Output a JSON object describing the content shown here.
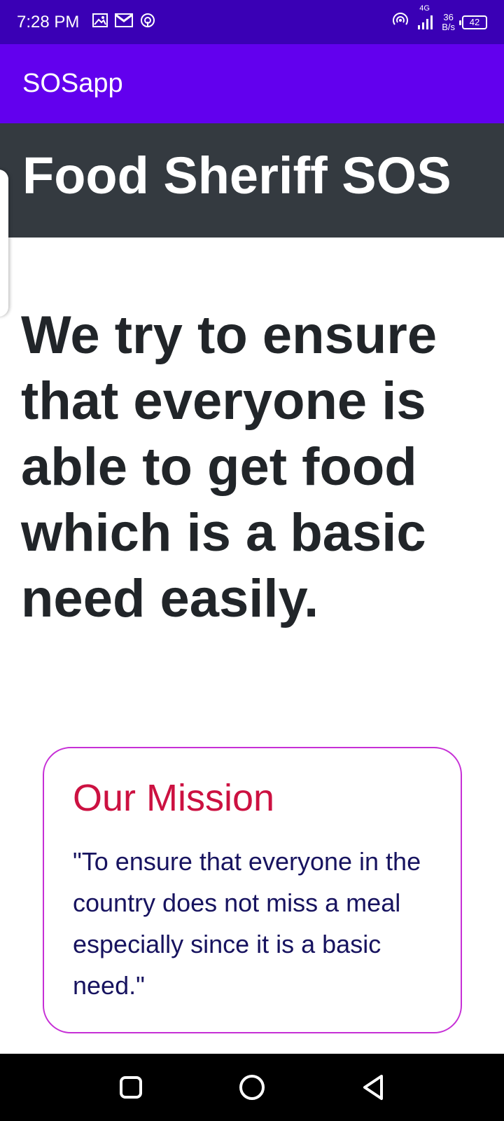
{
  "status_bar": {
    "time": "7:28 PM",
    "network_type": "4G",
    "net_speed_value": "36",
    "net_speed_unit": "B/s",
    "battery": "42",
    "left_icons": [
      "gallery-icon",
      "gmail-icon",
      "hotspot-icon"
    ],
    "right_icons": [
      "hotspot-icon",
      "signal-icon",
      "battery-icon"
    ]
  },
  "app_bar": {
    "title": "SOSapp"
  },
  "site_header": {
    "title": "Food Sheriff SOS"
  },
  "hero": {
    "text": "We try to ensure that everyone is able to get food which is a basic need easily."
  },
  "mission": {
    "heading": "Our Mission",
    "text": "\"To ensure that everyone in the country does not miss a meal especially since it is a basic need.\""
  },
  "nav_bar": {
    "buttons": [
      "recents-icon",
      "home-icon",
      "back-icon"
    ]
  },
  "colors": {
    "status_bar": "#3a00b5",
    "app_bar": "#6200ee",
    "header": "#343a40",
    "hero_text": "#212529",
    "mission_heading": "#cc1141",
    "mission_text": "#17135f",
    "mission_border": "#c62fd6"
  }
}
